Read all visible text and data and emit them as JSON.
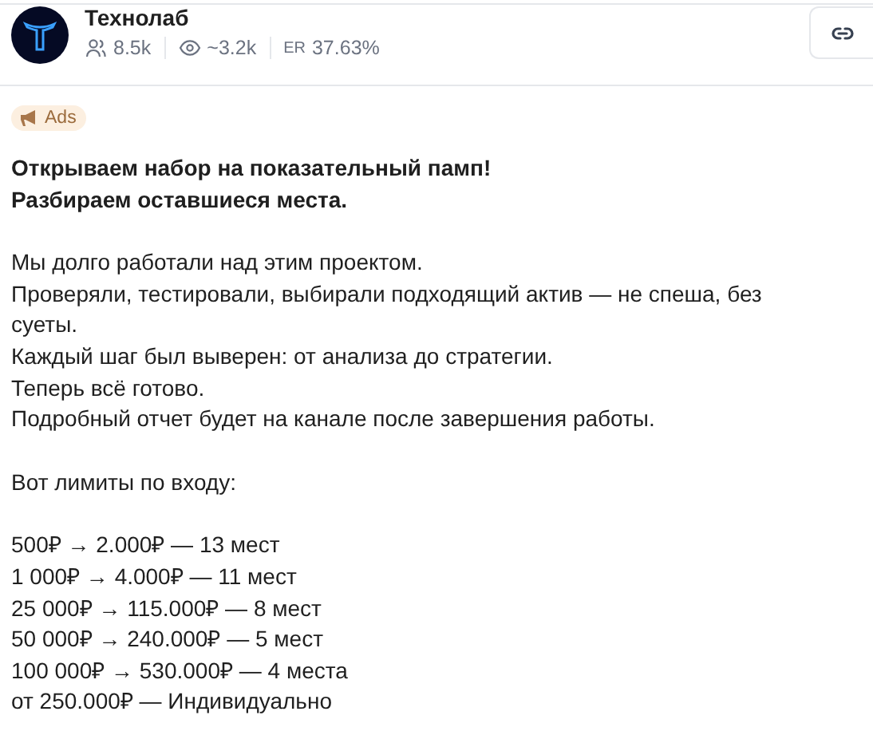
{
  "channel": {
    "name": "Технолаб",
    "subscribers": "8.5k",
    "views": "~3.2k",
    "er_label": "ER",
    "er": "37.63%"
  },
  "badge": {
    "label": "Ads"
  },
  "post": {
    "headline": [
      "Открываем набор на показательный памп!",
      "Разбираем оставшиеся места."
    ],
    "paragraphs": [
      [
        "Мы долго работали над этим проектом.",
        "Проверяли, тестировали, выбирали подходящий актив — не спеша, без суеты.",
        "Каждый шаг был выверен: от анализа до стратегии.",
        "Теперь всё готово.",
        "Подробный отчет будет на канале после завершения работы."
      ],
      [
        "Вот лимиты по входу:"
      ],
      [
        "500₽ → 2.000₽ — 13 мест",
        "1 000₽ → 4.000₽ — 11 мест",
        "25 000₽ → 115.000₽ — 8 мест",
        "50 000₽ → 240.000₽ — 5 мест",
        "100 000₽ → 530.000₽ — 4 места",
        "от 250.000₽ — Индивидуально"
      ]
    ]
  }
}
